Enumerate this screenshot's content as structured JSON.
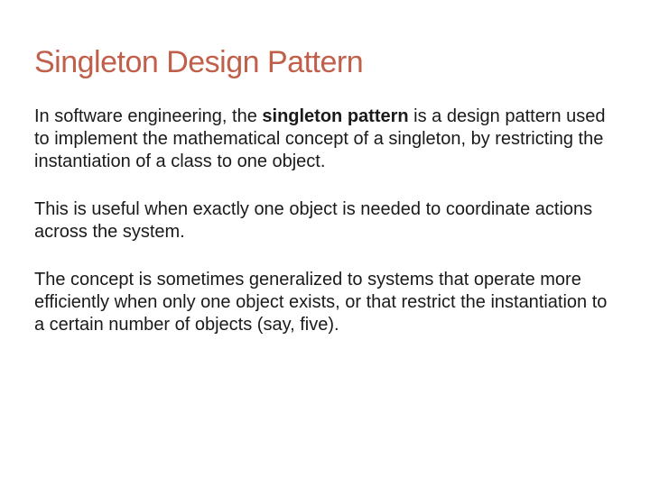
{
  "title": "Singleton Design Pattern",
  "para1_pre": "In software engineering, the ",
  "para1_bold": "singleton pattern",
  "para1_post": " is a design pattern used to implement the mathematical concept of a singleton, by restricting the instantiation of a class to one object.",
  "para2": "This is useful when exactly one object is needed to coordinate actions across the system.",
  "para3": "The concept is sometimes generalized to systems that operate more efficiently when only one object exists, or that restrict the instantiation to a certain number of objects (say, five)."
}
